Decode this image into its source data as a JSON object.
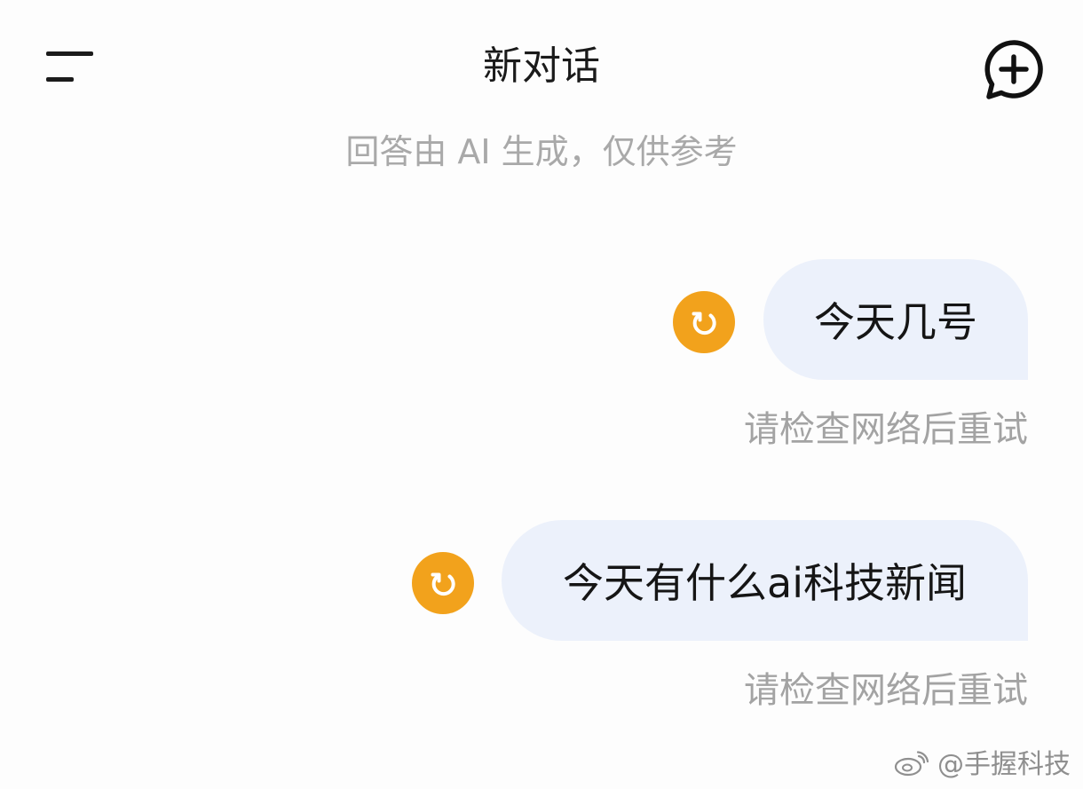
{
  "header": {
    "title": "新对话"
  },
  "disclaimer": "回答由 AI 生成，仅供参考",
  "messages": [
    {
      "text": "今天几号",
      "status": "请检查网络后重试"
    },
    {
      "text": "今天有什么ai科技新闻",
      "status": "请检查网络后重试"
    }
  ],
  "watermark": "@手握科技",
  "colors": {
    "bubble": "#ecf1fb",
    "retry_icon": "#f2a21c",
    "secondary_text": "#a9a9a9"
  }
}
